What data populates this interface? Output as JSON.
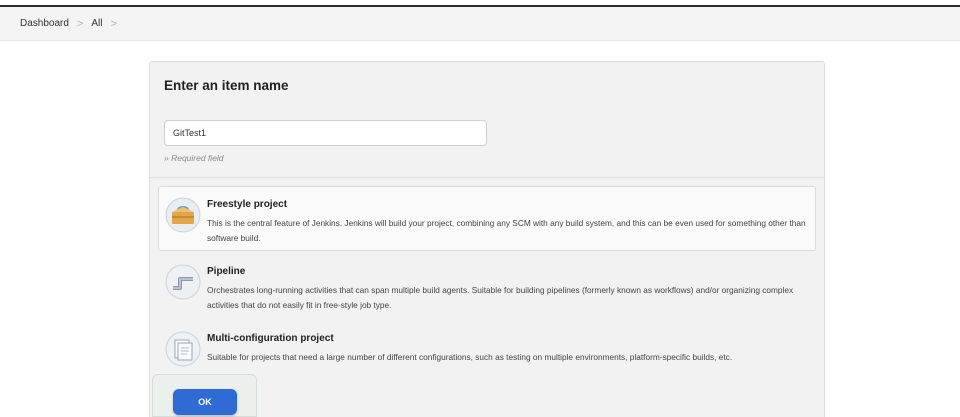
{
  "breadcrumb": {
    "items": [
      "Dashboard",
      "All"
    ],
    "separator": ">"
  },
  "form": {
    "title": "Enter an item name",
    "item_name_value": "GitTest1",
    "required_note": "» Required field"
  },
  "item_types": [
    {
      "title": "Freestyle project",
      "description": "This is the central feature of Jenkins. Jenkins will build your project, combining any SCM with any build system, and this can be even used for something other than software build.",
      "icon": "freestyle-project-icon",
      "selected": true
    },
    {
      "title": "Pipeline",
      "description": "Orchestrates long-running activities that can span multiple build agents. Suitable for building pipelines (formerly known as workflows) and/or organizing complex activities that do not easily fit in free-style job type.",
      "icon": "pipeline-icon",
      "selected": false
    },
    {
      "title": "Multi-configuration project",
      "description": "Suitable for projects that need a large number of different configurations, such as testing on multiple environments, platform-specific builds, etc.",
      "icon": "multi-configuration-icon",
      "selected": false
    }
  ],
  "actions": {
    "ok_label": "OK"
  },
  "colors": {
    "ok_button": "#2f6bd4",
    "panel_background": "#f2f2f2"
  }
}
